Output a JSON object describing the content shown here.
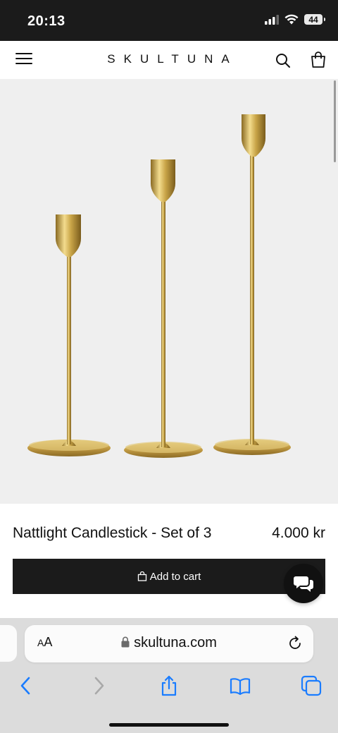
{
  "status_bar": {
    "time": "20:13",
    "battery": "44"
  },
  "header": {
    "brand": "SKULTUNA"
  },
  "hero": {
    "image_description_icon": "candlestick-set-image"
  },
  "product": {
    "title": "Nattlight Candlestick - Set of 3",
    "price": "4.000 kr"
  },
  "cart_button": {
    "label": "Add to cart",
    "icon": "bag-icon"
  },
  "chat": {
    "icon": "chat-bubbles-icon"
  },
  "browser": {
    "text_size_small": "A",
    "text_size_large": "A",
    "url": "skultuna.com",
    "accent": "#1a7cff"
  },
  "colors": {
    "brass": "#c8a24a",
    "dark": "#1b1b1b"
  }
}
